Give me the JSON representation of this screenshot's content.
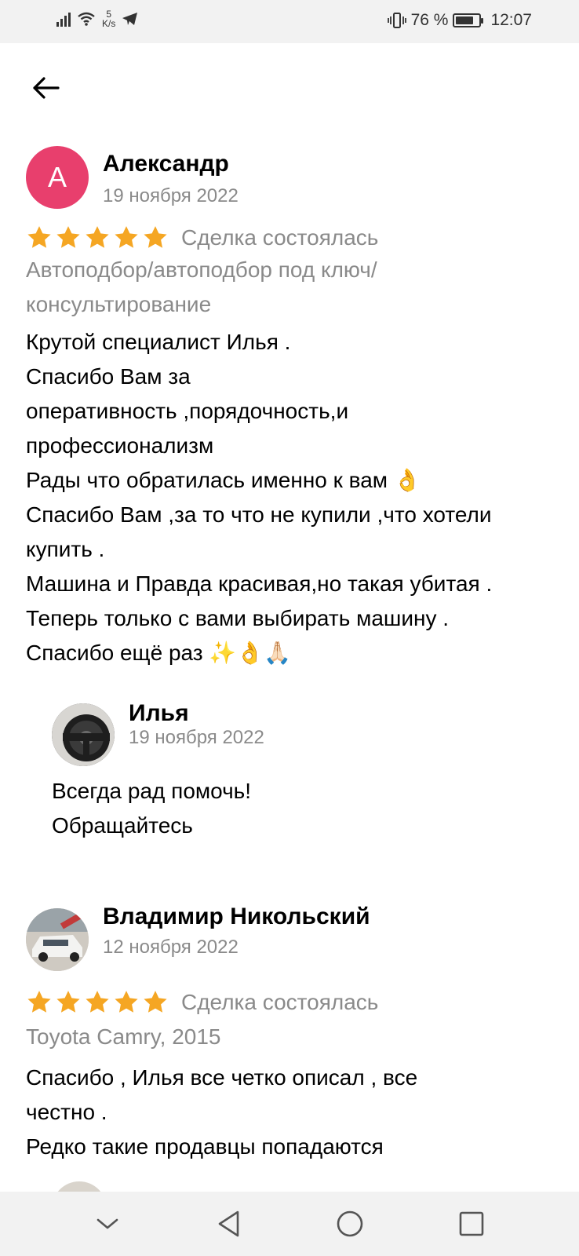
{
  "status_bar": {
    "net_speed_value": "5",
    "net_speed_unit": "K/s",
    "battery_percent": "76 %",
    "battery_level": 0.76,
    "time": "12:07"
  },
  "reviews": [
    {
      "author": "Александр",
      "avatar_letter": "А",
      "avatar_color": "#e83f6d",
      "date": "19 ноября 2022",
      "rating": 5,
      "deal_status": "Сделка состоялась",
      "service_lines": [
        "Автоподбор/автоподбор под ключ/",
        "консультирование"
      ],
      "text_lines": [
        "Крутой специалист Илья .",
        "Спасибо Вам за",
        "оперативность ,порядочность,и",
        "профессионализм",
        "Рады что обратилась именно к вам 👌",
        "Спасибо Вам ,за то что не купили ,что хотели",
        "купить .",
        "Машина и Правда красивая,но такая убитая .",
        "Теперь только с вами выбирать машину .",
        "Спасибо ещё раз ✨👌🙏🏻"
      ],
      "reply": {
        "author": "Илья",
        "date": "19 ноября 2022",
        "text_lines": [
          "Всегда рад помочь!",
          "Обращайтесь"
        ]
      }
    },
    {
      "author": "Владимир Никольский",
      "date": "12 ноября 2022",
      "rating": 5,
      "deal_status": "Сделка состоялась",
      "service_lines": [
        "Toyota Camry, 2015"
      ],
      "text_lines": [
        "Спасибо , Илья все четко описал , все",
        "честно .",
        "Редко такие продавцы попадаются"
      ]
    }
  ],
  "colors": {
    "star": "#f5a623",
    "secondary_text": "#8a8a8a",
    "system_bar": "#f2f2f2"
  }
}
